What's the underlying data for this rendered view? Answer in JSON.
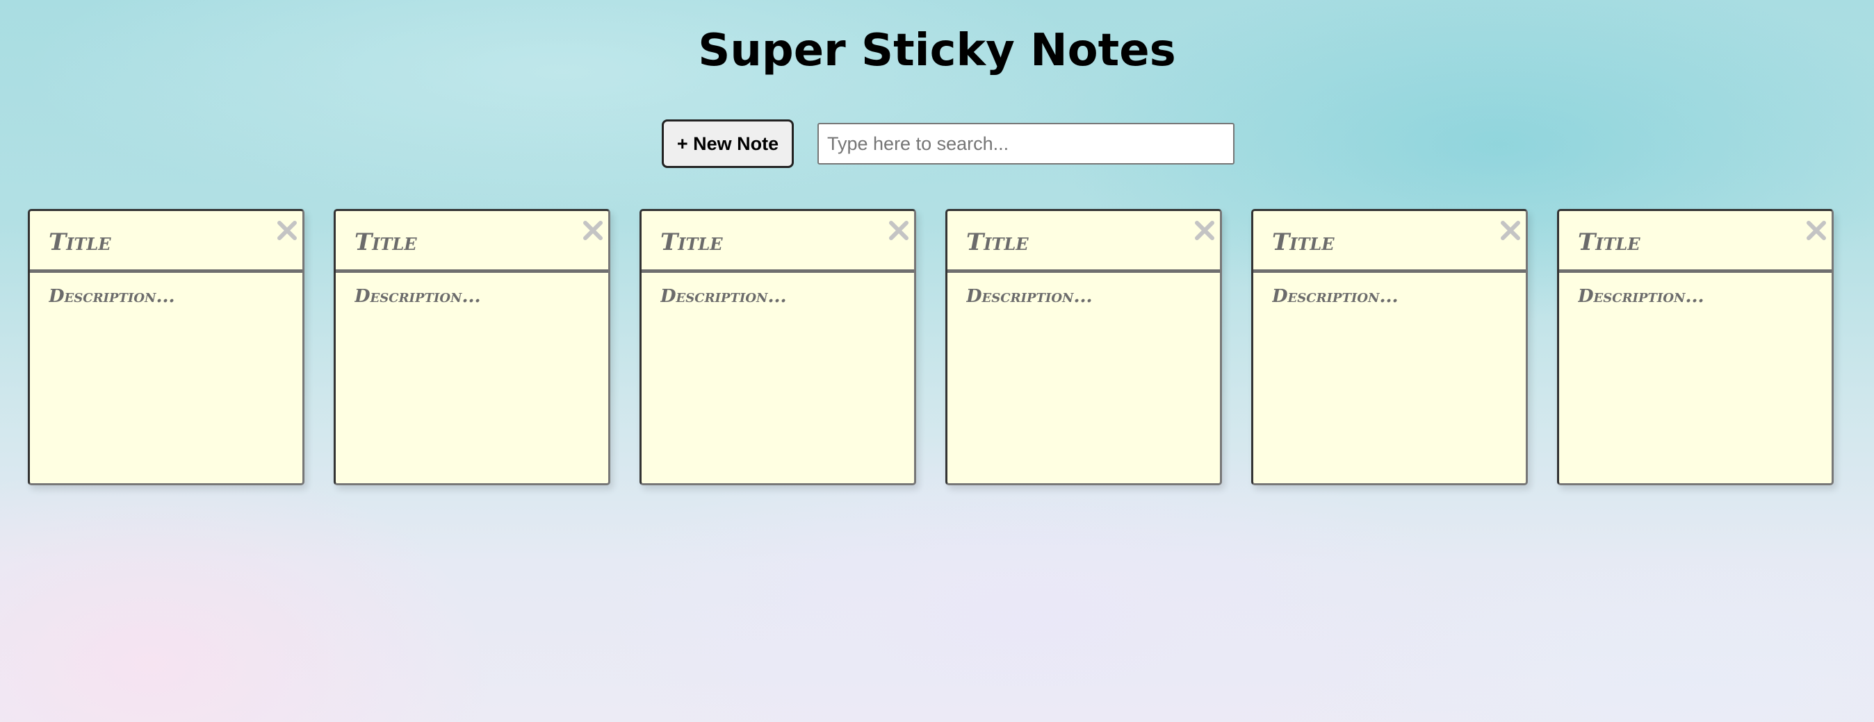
{
  "header": {
    "title": "Super Sticky Notes"
  },
  "controls": {
    "new_note_label": "+ New Note",
    "search_placeholder": "Type here to search...",
    "search_value": ""
  },
  "notes": [
    {
      "title_placeholder": "Title",
      "description_placeholder": "Description...",
      "delete_icon": "close-x"
    },
    {
      "title_placeholder": "Title",
      "description_placeholder": "Description...",
      "delete_icon": "close-x"
    },
    {
      "title_placeholder": "Title",
      "description_placeholder": "Description...",
      "delete_icon": "close-x"
    },
    {
      "title_placeholder": "Title",
      "description_placeholder": "Description...",
      "delete_icon": "close-x"
    },
    {
      "title_placeholder": "Title",
      "description_placeholder": "Description...",
      "delete_icon": "close-x"
    },
    {
      "title_placeholder": "Title",
      "description_placeholder": "Description...",
      "delete_icon": "close-x"
    }
  ],
  "colors": {
    "note_background": "#ffffe2",
    "note_text": "#6b6b6b",
    "delete_icon": "#c4c4c4"
  }
}
